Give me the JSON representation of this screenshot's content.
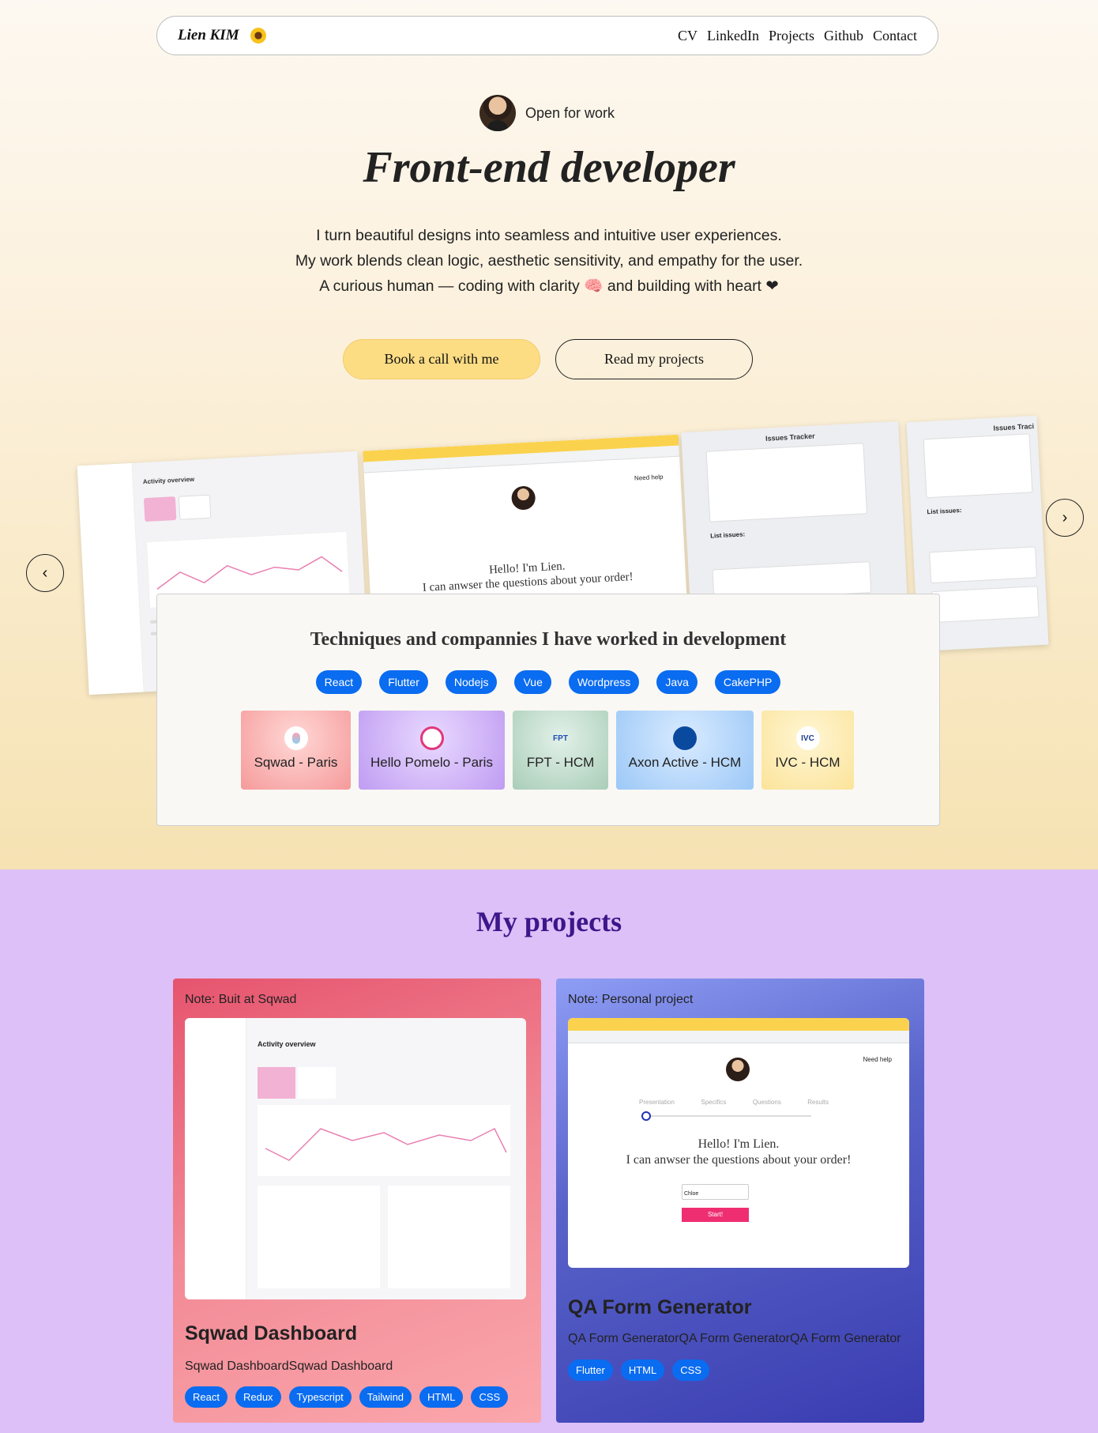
{
  "nav": {
    "brand": "Lien KIM",
    "links": [
      "CV",
      "LinkedIn",
      "Projects",
      "Github",
      "Contact"
    ]
  },
  "hero": {
    "status": "Open for work",
    "headline": "Front-end developer",
    "intro": [
      "I turn beautiful designs into seamless and intuitive user experiences.",
      "My work blends clean logic, aesthetic sensitivity, and empathy for the user.",
      "A curious human — coding with clarity 🧠 and building with heart ❤"
    ],
    "primary_button": "Book a call with me",
    "secondary_button": "Read my projects"
  },
  "carousel": {
    "slides": [
      {
        "caption": "Activity overview"
      },
      {
        "caption": "Hello! I'm Lien.",
        "caption2": "I can anwser the questions about your order!",
        "need_help": "Need help"
      },
      {
        "caption": "Issues Tracker",
        "sub": "List issues:"
      },
      {
        "caption": "Issues Traci",
        "sub": "List issues:"
      }
    ]
  },
  "techniques": {
    "title": "Techniques and compannies I have worked in development",
    "tags": [
      "React",
      "Flutter",
      "Nodejs",
      "Vue",
      "Wordpress",
      "Java",
      "CakePHP"
    ],
    "companies": [
      "Sqwad - Paris",
      "Hello Pomelo - Paris",
      "FPT - HCM",
      "Axon Active - HCM",
      "IVC - HCM"
    ]
  },
  "projects": {
    "title": "My projects",
    "items": [
      {
        "note": "Note: Buit at Sqwad",
        "title": "Sqwad Dashboard",
        "description": "Sqwad DashboardSqwad Dashboard",
        "tags": [
          "React",
          "Redux",
          "Typescript",
          "Tailwind",
          "HTML",
          "CSS"
        ],
        "shot_heading": "Activity overview"
      },
      {
        "note": "Note: Personal project",
        "title": "QA Form Generator",
        "description": "QA Form GeneratorQA Form GeneratorQA Form Generator",
        "tags": [
          "Flutter",
          "HTML",
          "CSS"
        ],
        "shot_line1": "Hello! I'm Lien.",
        "shot_line2": "I can anwser the questions about your order!",
        "shot_steps": [
          "Presentation",
          "Specifics",
          "Questions",
          "Results"
        ],
        "shot_input": "Chloe",
        "shot_button": "Start!",
        "shot_help": "Need help"
      }
    ]
  }
}
